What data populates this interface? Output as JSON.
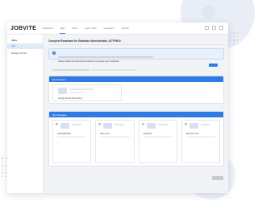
{
  "header": {
    "logo": "JOBVITE",
    "nav": [
      {
        "label": "Dashboard",
        "active": false
      },
      {
        "label": "Jobs",
        "active": true
      },
      {
        "label": "Talent",
        "active": false
      },
      {
        "label": "Career Sites",
        "active": false
      },
      {
        "label": "Campaigns",
        "active": false
      },
      {
        "label": "Reports",
        "active": false
      }
    ]
  },
  "sidebar": {
    "title": "Jobs",
    "items": [
      {
        "label": "Jobs",
        "active": true
      },
      {
        "label": "Manage Job Ads",
        "active": false
      }
    ]
  },
  "main": {
    "title": "Complete Broadcast for Database Administrator, 2077RH15",
    "alert": "Please follow the instructions below to complete your broadcast"
  },
  "favorites": {
    "header": "My Favorites",
    "items": [
      {
        "label": "Simply Hired (Premium)"
      }
    ]
  },
  "packages": {
    "header": "My Packages",
    "items": [
      {
        "label": "CareerBuilder"
      },
      {
        "label": "Dice.com"
      },
      {
        "label": "LinkedIn"
      },
      {
        "label": "Monster.com"
      }
    ]
  },
  "colors": {
    "accent": "#2f7be5",
    "alert_bg": "#e7f0fb",
    "content_bg": "#f1f3f7"
  }
}
